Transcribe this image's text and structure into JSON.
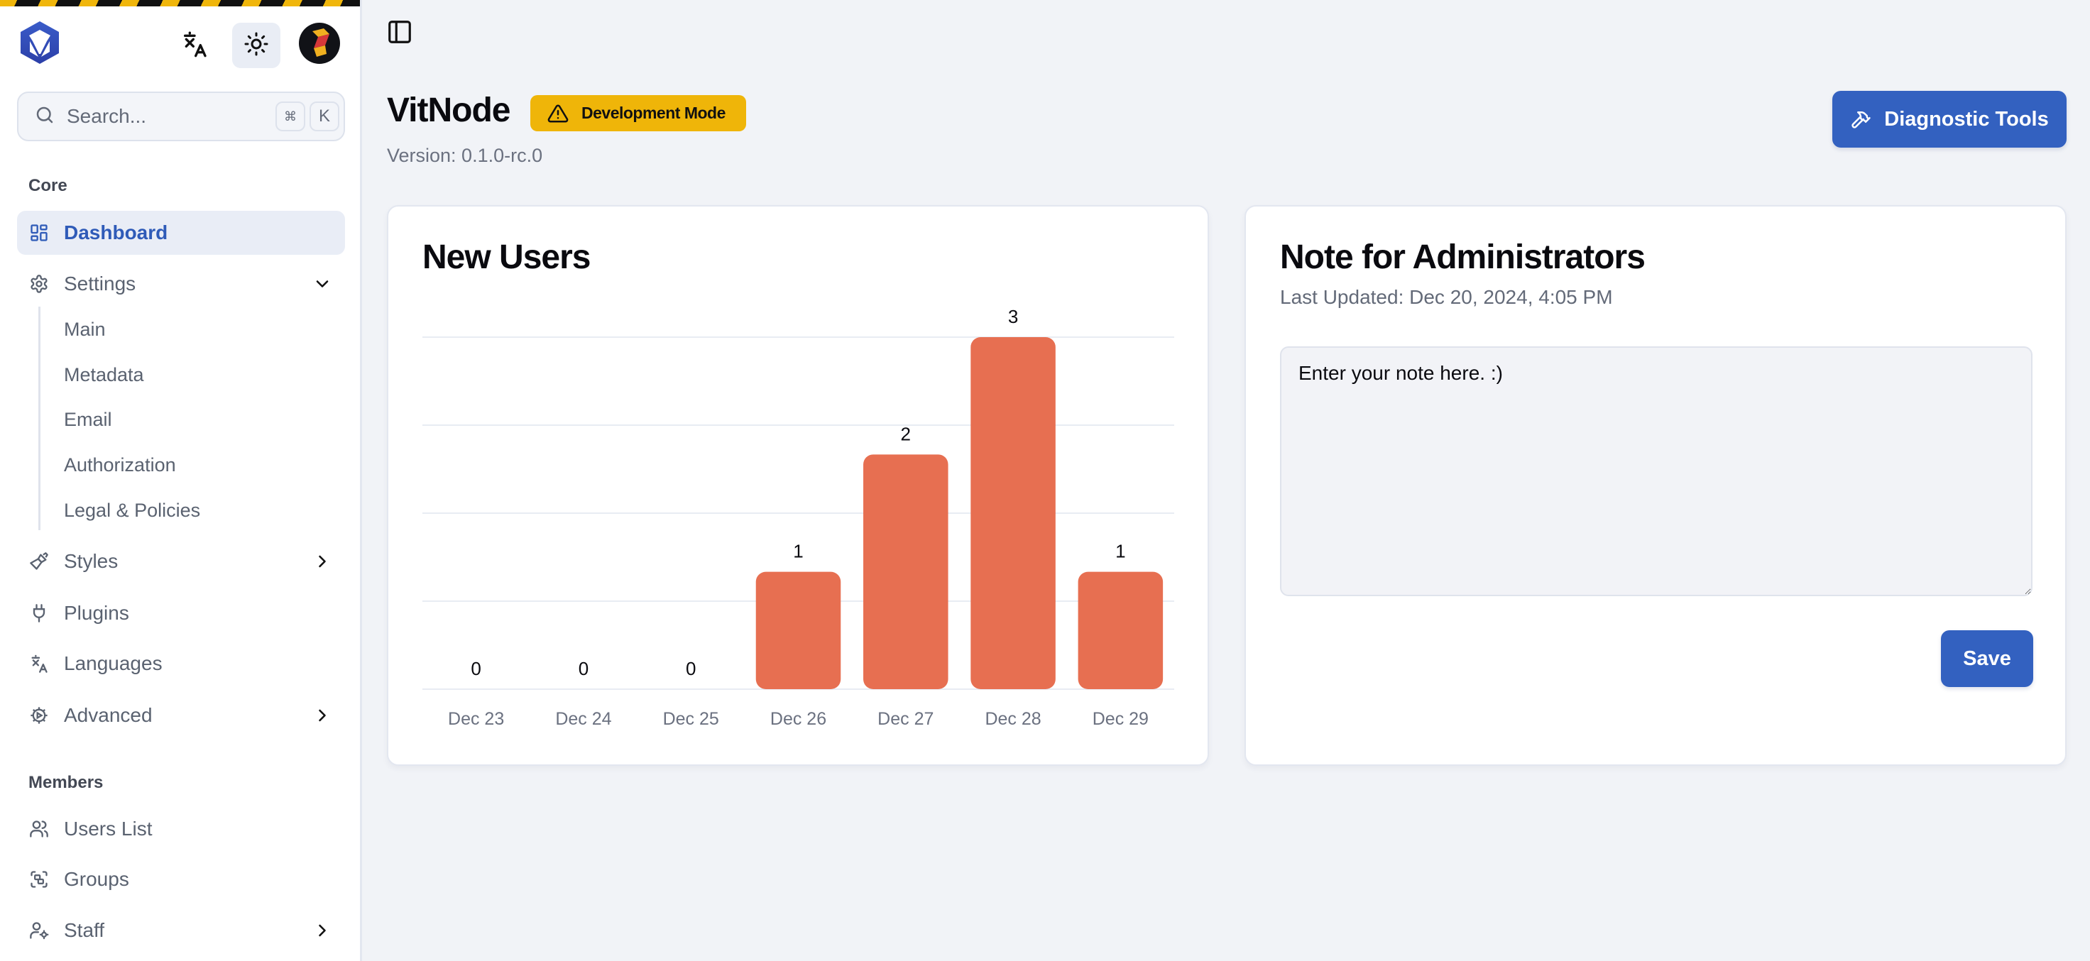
{
  "sidebar": {
    "search": {
      "placeholder": "Search...",
      "shortcut_mod": "⌘",
      "shortcut_key": "K"
    },
    "top_icons": {
      "translate": "translate-icon",
      "theme": "sun-icon",
      "avatar": "user-avatar"
    },
    "sections": [
      {
        "label": "Core",
        "items": [
          {
            "label": "Dashboard",
            "icon": "dashboard-icon",
            "active": true
          },
          {
            "label": "Settings",
            "icon": "gear-icon",
            "expanded": true,
            "children": [
              "Main",
              "Metadata",
              "Email",
              "Authorization",
              "Legal & Policies"
            ]
          },
          {
            "label": "Styles",
            "icon": "brush-icon",
            "has_children": true
          },
          {
            "label": "Plugins",
            "icon": "plug-icon"
          },
          {
            "label": "Languages",
            "icon": "translate-icon"
          },
          {
            "label": "Advanced",
            "icon": "cog-play-icon",
            "has_children": true
          }
        ]
      },
      {
        "label": "Members",
        "items": [
          {
            "label": "Users List",
            "icon": "users-icon"
          },
          {
            "label": "Groups",
            "icon": "group-icon"
          },
          {
            "label": "Staff",
            "icon": "user-cog-icon",
            "has_children": true
          }
        ]
      }
    ]
  },
  "header": {
    "title": "VitNode",
    "badge": "Development Mode",
    "version": "Version: 0.1.0-rc.0",
    "diagnostic_button": "Diagnostic Tools"
  },
  "new_users_card": {
    "title": "New Users"
  },
  "note_card": {
    "title": "Note for Administrators",
    "last_updated": "Last Updated: Dec 20, 2024, 4:05 PM",
    "note_value": "Enter your note here. :)",
    "save_label": "Save"
  },
  "colors": {
    "accent": "#3361c0",
    "bar": "#e76f51",
    "badge": "#efb509"
  },
  "chart_data": {
    "type": "bar",
    "title": "New Users",
    "categories": [
      "Dec 23",
      "Dec 24",
      "Dec 25",
      "Dec 26",
      "Dec 27",
      "Dec 28",
      "Dec 29"
    ],
    "values": [
      0,
      0,
      0,
      1,
      2,
      3,
      1
    ],
    "xlabel": "",
    "ylabel": "",
    "ylim": [
      0,
      3
    ],
    "gridlines": [
      0,
      0.75,
      1.5,
      2.25,
      3
    ],
    "grid": true,
    "data_labels": true,
    "legend": "none"
  }
}
